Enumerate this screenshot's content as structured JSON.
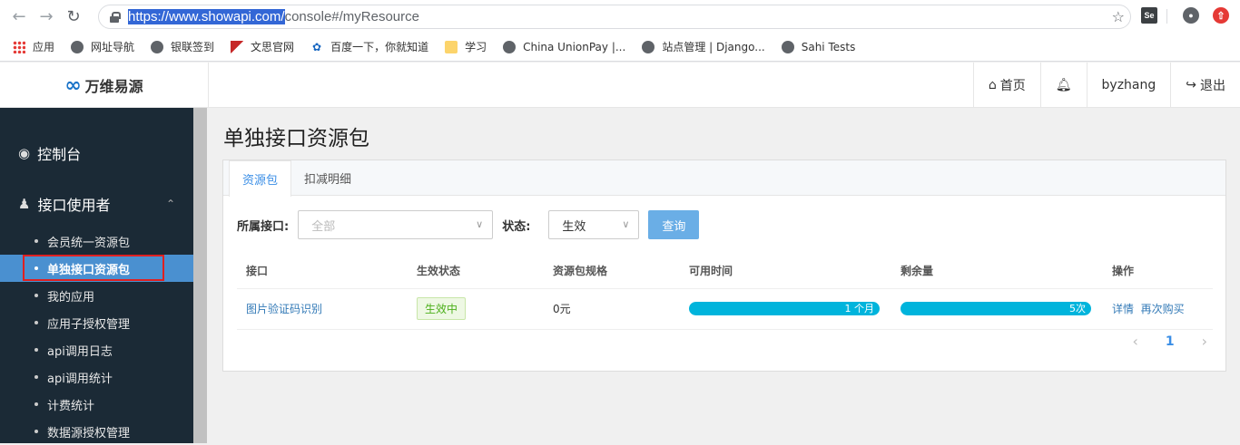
{
  "browser": {
    "url_selected": "https://www.showapi.com/",
    "url_rest": "console#/myResource",
    "bookmarks": [
      "应用",
      "网址导航",
      "银联签到",
      "文思官网",
      "百度一下，你就知道",
      "学习",
      "China UnionPay |...",
      "站点管理 | Django...",
      "Sahi Tests"
    ]
  },
  "header": {
    "logo_text": "万维易源",
    "home": "首页",
    "user": "byzhang",
    "logout": "退出"
  },
  "sidebar": {
    "console": "控制台",
    "users_group": "接口使用者",
    "items": [
      "会员统一资源包",
      "单独接口资源包",
      "我的应用",
      "应用子授权管理",
      "api调用日志",
      "api调用统计",
      "计费统计",
      "数据源授权管理"
    ]
  },
  "main": {
    "title": "单独接口资源包",
    "tabs": [
      "资源包",
      "扣减明细"
    ],
    "filter_api_label": "所属接口:",
    "filter_api_value": "全部",
    "filter_status_label": "状态:",
    "filter_status_value": "生效",
    "query_button": "查询",
    "columns": [
      "接口",
      "生效状态",
      "资源包规格",
      "可用时间",
      "剩余量",
      "操作"
    ],
    "rows": [
      {
        "api": "图片验证码识别",
        "status": "生效中",
        "spec": "0元",
        "time": "1 个月",
        "time_pct": 100,
        "remain": "5次",
        "remain_pct": 100,
        "action_detail": "详情",
        "action_rebuy": "再次购买"
      }
    ],
    "page": "1"
  }
}
